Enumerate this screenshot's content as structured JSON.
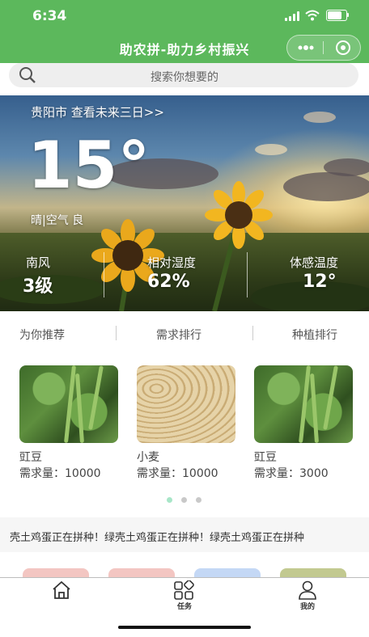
{
  "status_bar": {
    "time": "6:34"
  },
  "header": {
    "title": "助农拼-助力乡村振兴",
    "more_icon": "more-dots-icon",
    "close_icon": "target-circle-icon"
  },
  "search": {
    "placeholder": "搜索你想要的",
    "icon": "search-icon"
  },
  "weather": {
    "city_link": "贵阳市 查看未来三日>>",
    "temperature": "15°",
    "condition": "晴|空气 良",
    "stats": [
      {
        "label": "南风",
        "value": "3级"
      },
      {
        "label": "相对湿度",
        "value": "62%"
      },
      {
        "label": "体感温度",
        "value": "12°"
      }
    ]
  },
  "tabs": [
    "为你推荐",
    "需求排行",
    "种植排行"
  ],
  "products": [
    {
      "name": "豇豆",
      "demand": "需求量：10000"
    },
    {
      "name": "小麦",
      "demand": "需求量：10000"
    },
    {
      "name": "豇豆",
      "demand": "需求量：3000"
    }
  ],
  "carousel": {
    "active_index": 0,
    "count": 3,
    "active_color": "#a8e6c8",
    "inactive_color": "#c9c9c9"
  },
  "ticker": {
    "text": "壳土鸡蛋正在拼种！绿壳土鸡蛋正在拼种！绿壳土鸡蛋正在拼种"
  },
  "chips": {
    "colors": [
      "#f3c6c2",
      "#f3c6c2",
      "#c4d8f5",
      "#c2c990"
    ]
  },
  "bottom_nav": [
    {
      "label": "",
      "icon": "home-icon"
    },
    {
      "label": "任务",
      "icon": "grid-tasks-icon"
    },
    {
      "label": "我的",
      "icon": "user-icon"
    }
  ],
  "colors": {
    "brand_green": "#5cb85c"
  }
}
